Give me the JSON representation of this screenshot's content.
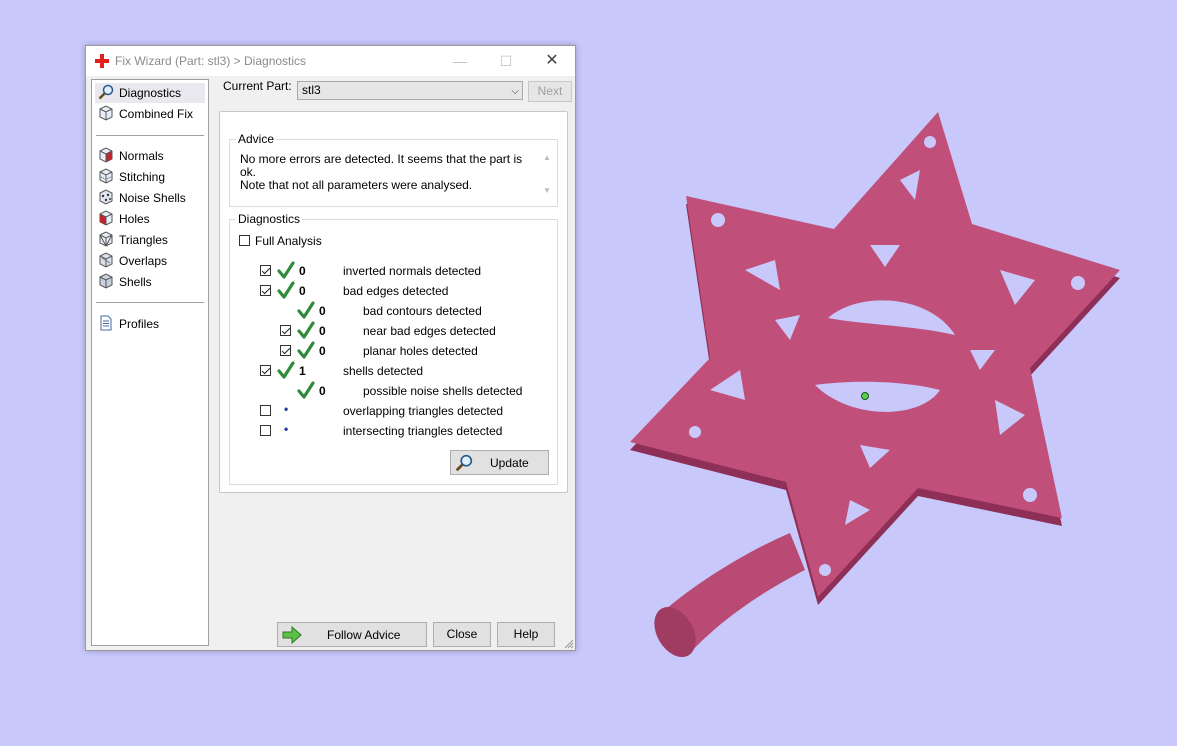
{
  "window": {
    "title": "Fix Wizard (Part: stl3) > Diagnostics",
    "min_glyph": "—",
    "max_glyph": "☐",
    "close_glyph": "✕"
  },
  "sidebar": {
    "items": [
      {
        "label": "Diagnostics",
        "icon": "magnifier-icon",
        "active": true
      },
      {
        "label": "Combined Fix",
        "icon": "cube-icon"
      },
      {
        "label": "Normals",
        "icon": "normals-cube-icon"
      },
      {
        "label": "Stitching",
        "icon": "stitching-cube-icon"
      },
      {
        "label": "Noise Shells",
        "icon": "noise-shells-icon"
      },
      {
        "label": "Holes",
        "icon": "holes-cube-icon"
      },
      {
        "label": "Triangles",
        "icon": "triangles-cube-icon"
      },
      {
        "label": "Overlaps",
        "icon": "overlaps-cube-icon"
      },
      {
        "label": "Shells",
        "icon": "shells-cube-icon"
      },
      {
        "label": "Profiles",
        "icon": "document-icon"
      }
    ]
  },
  "header": {
    "current_part_label": "Current Part:",
    "current_part_value": "stl3",
    "next_label": "Next"
  },
  "advice": {
    "title": "Advice",
    "line1": "No more errors are detected. It seems that the part is ok.",
    "line2": "Note that not all parameters were analysed."
  },
  "diagnostics": {
    "title": "Diagnostics",
    "full_analysis_label": "Full Analysis",
    "rows": [
      {
        "checked": true,
        "status": "ok",
        "value": "0",
        "label": "inverted normals detected"
      },
      {
        "checked": true,
        "status": "ok",
        "value": "0",
        "label": "bad edges detected"
      },
      {
        "checked": null,
        "status": "ok",
        "value": "0",
        "label": "bad contours detected"
      },
      {
        "checked": true,
        "status": "ok",
        "value": "0",
        "label": "near bad edges detected"
      },
      {
        "checked": true,
        "status": "ok",
        "value": "0",
        "label": "planar holes detected"
      },
      {
        "checked": true,
        "status": "ok",
        "value": "1",
        "label": "shells detected"
      },
      {
        "checked": null,
        "status": "ok",
        "value": "0",
        "label": "possible noise shells detected"
      },
      {
        "checked": false,
        "status": "pending",
        "value": "•",
        "label": "overlapping triangles detected"
      },
      {
        "checked": false,
        "status": "pending",
        "value": "•",
        "label": "intersecting triangles detected"
      }
    ],
    "update_label": "Update"
  },
  "footer": {
    "follow_advice_label": "Follow Advice",
    "close_label": "Close",
    "help_label": "Help"
  },
  "colors": {
    "background": "#c8c8fb",
    "model": "#c0507a",
    "check_green": "#2e8b3a"
  }
}
